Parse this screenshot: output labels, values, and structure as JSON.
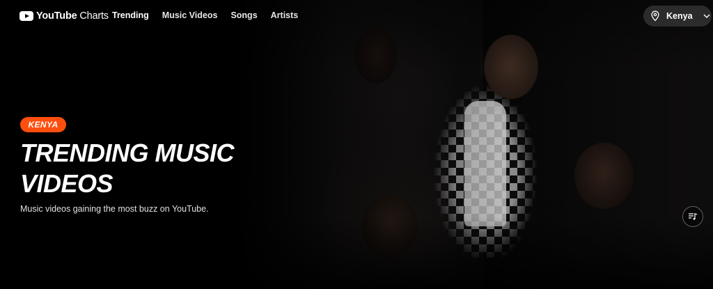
{
  "app": {
    "logo_text_bold": "YouTube",
    "logo_text": " Charts"
  },
  "nav": {
    "items": [
      {
        "label": "Trending",
        "active": true
      },
      {
        "label": "Music Videos",
        "active": false
      },
      {
        "label": "Songs",
        "active": false
      },
      {
        "label": "Artists",
        "active": false
      }
    ]
  },
  "country_selector": {
    "value": "Kenya",
    "icon": "location-pin-icon"
  },
  "hero": {
    "badge": "KENYA",
    "title": "TRENDING MUSIC VIDEOS",
    "subtitle": "Music videos gaining the most buzz on YouTube.",
    "playlist_icon": "playlist-music-icon"
  },
  "colors": {
    "accent": "#ff4e0d",
    "background": "#000000",
    "selector_bg": "#303030"
  }
}
